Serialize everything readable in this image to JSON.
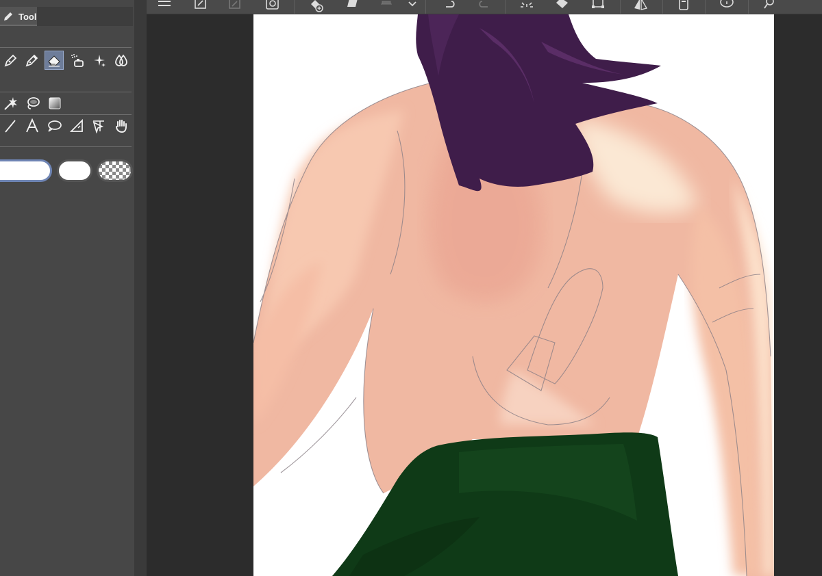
{
  "tool_panel": {
    "tab_label": "Tool",
    "tab_icon": "pencil-icon",
    "row1_tools": [
      "pen-icon",
      "pencil-icon",
      "eraser-icon",
      "airbrush-icon",
      "decoration-icon",
      "blend-icon"
    ],
    "row1_selected": "eraser-icon",
    "row2_tools": [
      "auto-select-icon",
      "lasso-fill-icon",
      "gradient-icon"
    ],
    "row3_tools": [
      "line-icon",
      "text-icon",
      "speech-balloon-icon",
      "ruler-icon",
      "operation-icon",
      "hand-icon"
    ],
    "color_options": [
      "main-color",
      "sub-color",
      "transparent-color"
    ],
    "selected_color_option": "main-color"
  },
  "command_bar": {
    "icons": [
      "menu-icon",
      "export-icon",
      "edit-icon",
      "layer-copy-icon",
      "add-layer-icon",
      "fill-icon",
      "clear-icon",
      "chevron-down-icon",
      "undo-icon",
      "redo-icon",
      "loading-icon",
      "fill-bucket-icon",
      "transform-icon",
      "flip-icon",
      "device-icon",
      "balloon-icon",
      "settings-icon"
    ]
  },
  "colors": {
    "panel_bg": "#474747",
    "canvas_area_bg": "#2c2c2c",
    "selection_accent": "#6f85b4",
    "hair": "#3f1d4a",
    "skin": "#f0b8a2",
    "pants": "#0f3a17"
  }
}
